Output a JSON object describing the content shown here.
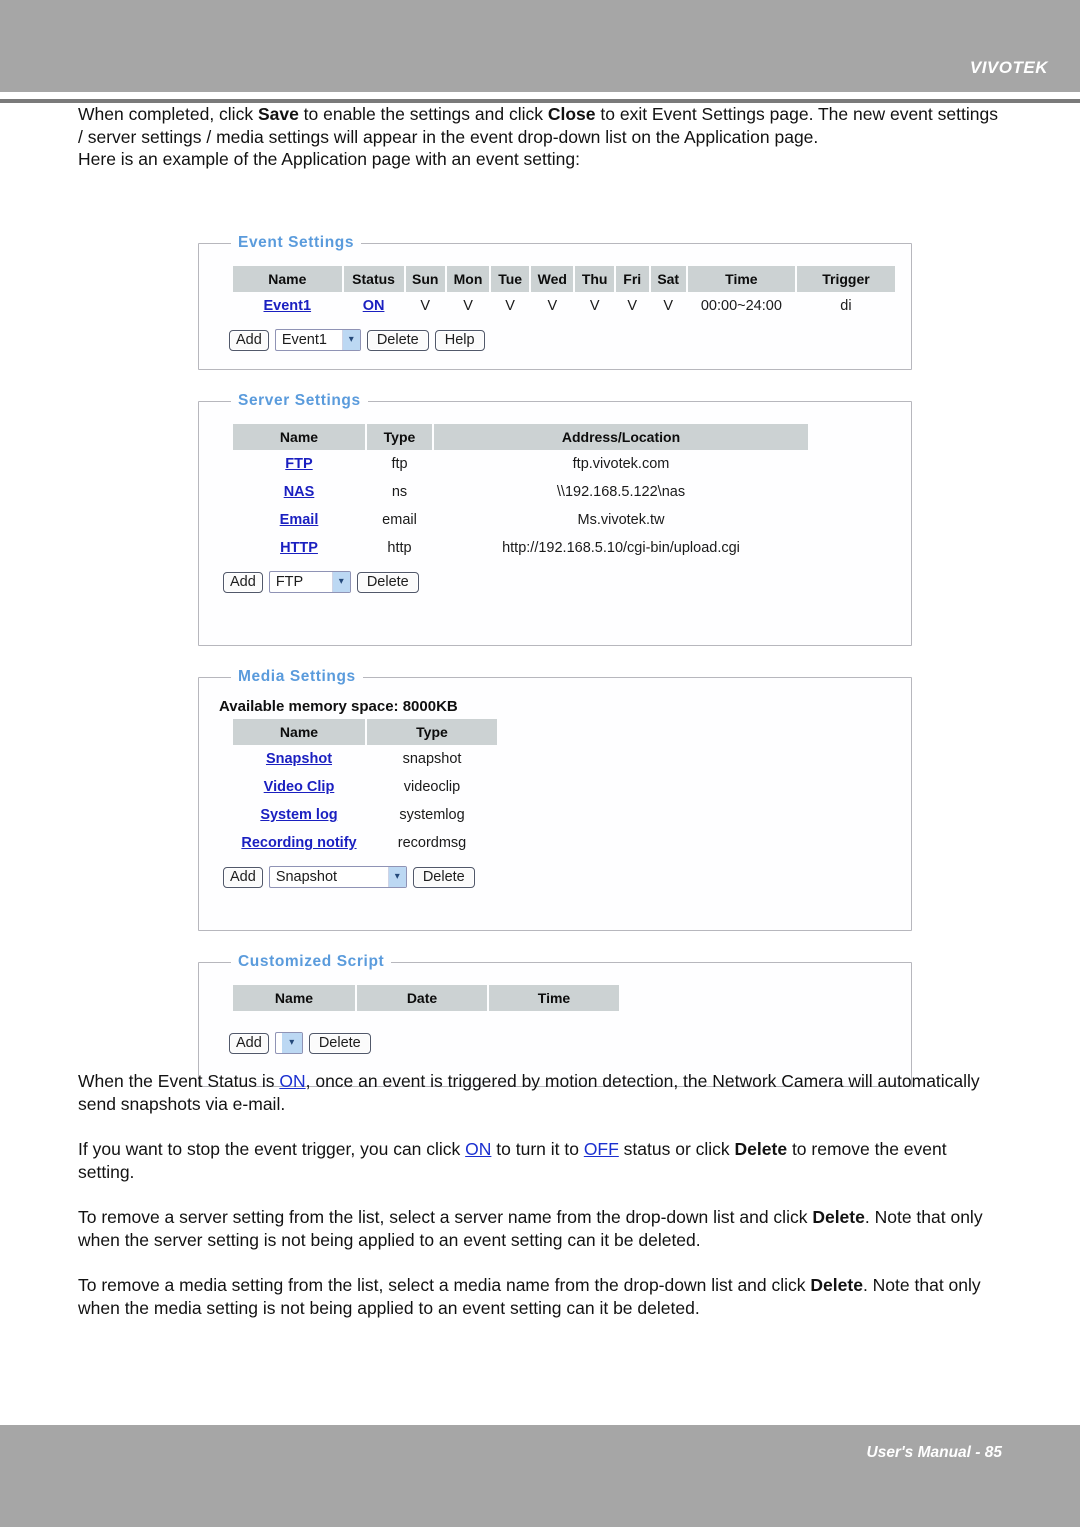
{
  "header": {
    "brand": "VIVOTEK"
  },
  "footer": {
    "text": "User's Manual - 85"
  },
  "intro": {
    "line1_a": "When completed, click ",
    "line1_save": "Save",
    "line1_b": " to enable the settings and click ",
    "line1_close": "Close",
    "line1_c": " to exit Event Settings page. The new event settings / server settings / media settings will appear in the event drop-down list on the Application page.",
    "line2": "Here is an example of the Application page with an event setting:"
  },
  "event_settings": {
    "legend": "Event Settings",
    "columns": [
      "Name",
      "Status",
      "Sun",
      "Mon",
      "Tue",
      "Wed",
      "Thu",
      "Fri",
      "Sat",
      "Time",
      "Trigger"
    ],
    "rows": [
      {
        "name": "Event1",
        "status": "ON",
        "sun": "V",
        "mon": "V",
        "tue": "V",
        "wed": "V",
        "thu": "V",
        "fri": "V",
        "sat": "V",
        "time": "00:00~24:00",
        "trigger": "di"
      }
    ],
    "controls": {
      "add_label": "Add",
      "select_value": "Event1",
      "delete_label": "Delete",
      "help_label": "Help"
    }
  },
  "server_settings": {
    "legend": "Server Settings",
    "columns": [
      "Name",
      "Type",
      "Address/Location"
    ],
    "rows": [
      {
        "name": "FTP",
        "type": "ftp",
        "address": "ftp.vivotek.com"
      },
      {
        "name": "NAS",
        "type": "ns",
        "address": "\\\\192.168.5.122\\nas"
      },
      {
        "name": "Email",
        "type": "email",
        "address": "Ms.vivotek.tw"
      },
      {
        "name": "HTTP",
        "type": "http",
        "address": "http://192.168.5.10/cgi-bin/upload.cgi"
      }
    ],
    "controls": {
      "add_label": "Add",
      "select_value": "FTP",
      "delete_label": "Delete"
    }
  },
  "media_settings": {
    "legend": "Media Settings",
    "memory_line": "Available memory space: 8000KB",
    "columns": [
      "Name",
      "Type"
    ],
    "rows": [
      {
        "name": "Snapshot",
        "type": "snapshot"
      },
      {
        "name": "Video Clip",
        "type": "videoclip"
      },
      {
        "name": "System log",
        "type": "systemlog"
      },
      {
        "name": "Recording notify",
        "type": "recordmsg"
      }
    ],
    "controls": {
      "add_label": "Add",
      "select_value": "Snapshot",
      "delete_label": "Delete"
    }
  },
  "customized_script": {
    "legend": "Customized Script",
    "columns": [
      "Name",
      "Date",
      "Time"
    ],
    "rows": [],
    "controls": {
      "add_label": "Add",
      "select_value": "",
      "delete_label": "Delete"
    }
  },
  "notes": {
    "p1_a": "When the Event Status is ",
    "p1_on": "ON",
    "p1_b": ", once an event is triggered by motion detection, the Network Camera will automatically send snapshots via e-mail.",
    "p2_a": "If you want to stop the event trigger, you can click ",
    "p2_on": "ON",
    "p2_b": " to turn it to ",
    "p2_off": "OFF",
    "p2_c": " status or click ",
    "p2_delete": "Delete",
    "p2_d": " to remove the event setting.",
    "p3_a": "To remove a server setting from the list, select a server name from the drop-down list and click ",
    "p3_delete": "Delete",
    "p3_b": ". Note that only when the server setting is not being applied to an event setting can it be deleted.",
    "p4_a": "To remove a media setting from the list, select a media name from the drop-down list and click ",
    "p4_delete": "Delete",
    "p4_b": ". Note that only when the media setting is not being applied to an event setting can it be deleted."
  },
  "icons": {
    "chevron_down": "▾"
  }
}
